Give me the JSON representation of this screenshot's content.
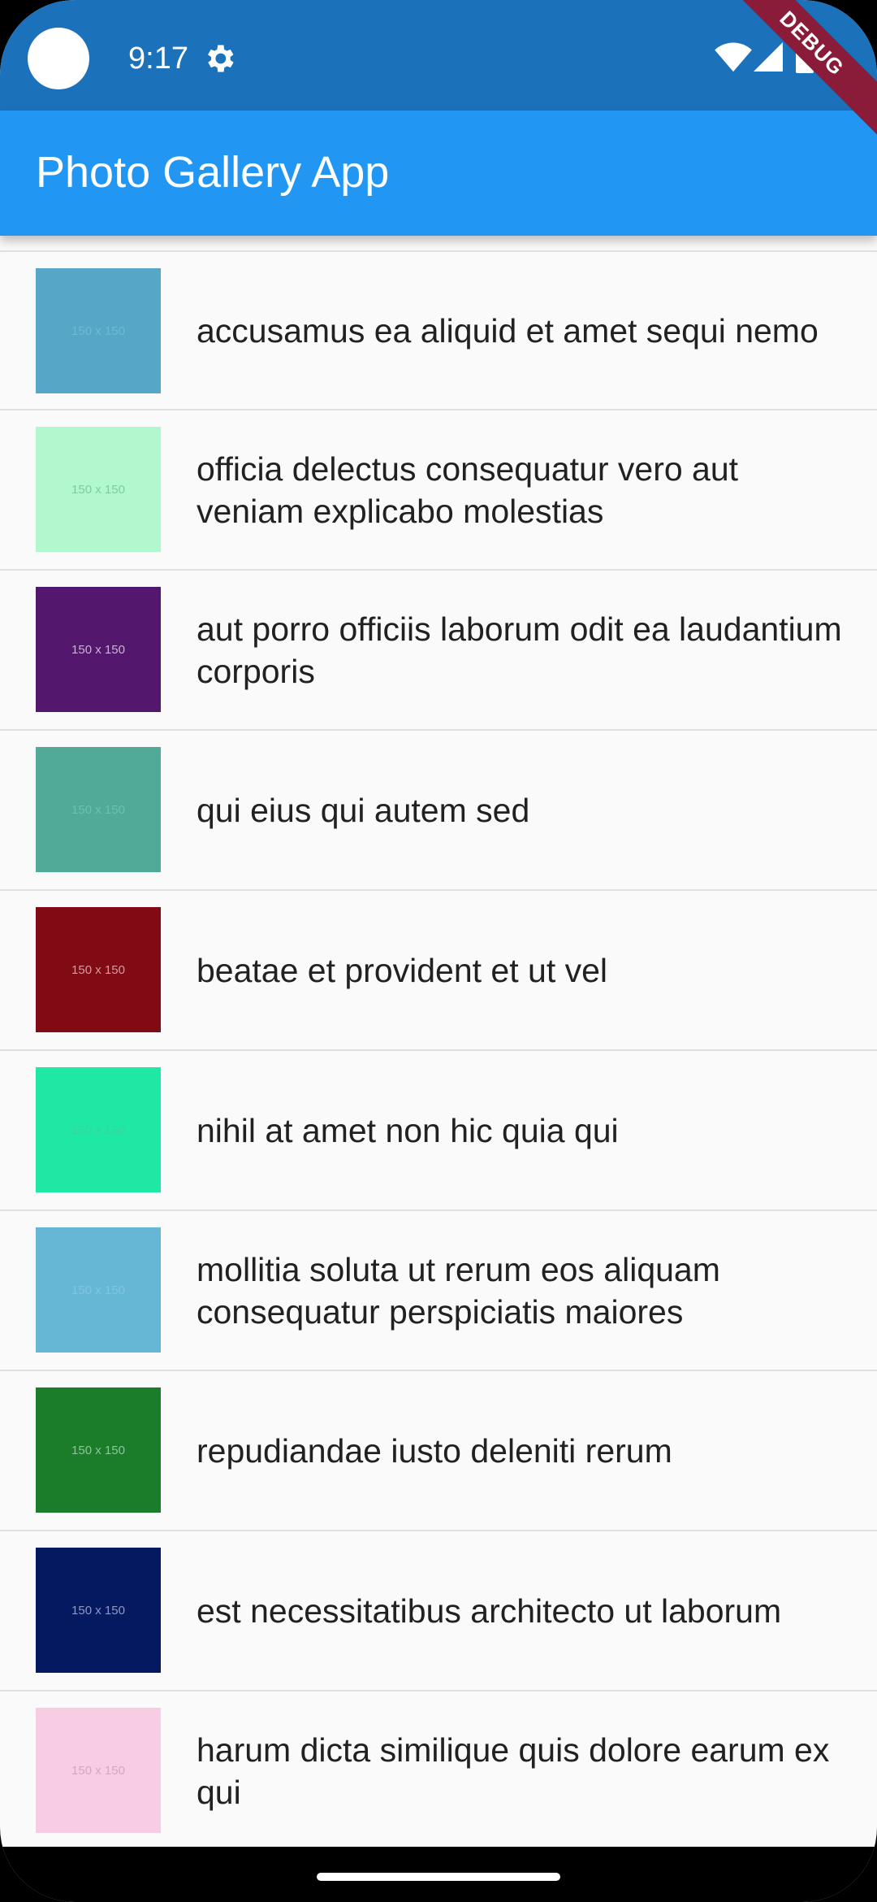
{
  "status_bar": {
    "time": "9:17",
    "icons": [
      "camera-dot",
      "settings-icon",
      "wifi-icon",
      "signal-icon",
      "battery-icon"
    ],
    "color": "#1c72ba"
  },
  "debug_banner": "DEBUG",
  "app_bar": {
    "title": "Photo Gallery App",
    "color": "#2196f3"
  },
  "photos": [
    {
      "title": "accusamus ea aliquid et amet sequi nemo",
      "thumb_label": "150 x 150",
      "color": "#56a6c8",
      "label_color": "#6fb8d6"
    },
    {
      "title": "officia delectus consequatur vero aut veniam explicabo molestias",
      "thumb_label": "150 x 150",
      "color": "#b1f8cf",
      "label_color": "#7fcca3"
    },
    {
      "title": "aut porro officiis laborum odit ea laudantium corporis",
      "thumb_label": "150 x 150",
      "color": "#54176e",
      "label_color": "#c9b2d6"
    },
    {
      "title": "qui eius qui autem sed",
      "thumb_label": "150 x 150",
      "color": "#51aa97",
      "label_color": "#6fbfae"
    },
    {
      "title": "beatae et provident et ut vel",
      "thumb_label": "150 x 150",
      "color": "#810b14",
      "label_color": "#d79aa0"
    },
    {
      "title": "nihil at amet non hic quia qui",
      "thumb_label": "150 x 150",
      "color": "#1ee8a4",
      "label_color": "#3bd4a0"
    },
    {
      "title": "mollitia soluta ut rerum eos aliquam consequatur perspiciatis maiores",
      "thumb_label": "150 x 150",
      "color": "#66b7d5",
      "label_color": "#7fc6e0"
    },
    {
      "title": "repudiandae iusto deleniti rerum",
      "thumb_label": "150 x 150",
      "color": "#1b7c2a",
      "label_color": "#8fc49a"
    },
    {
      "title": "est necessitatibus architecto ut laborum",
      "thumb_label": "150 x 150",
      "color": "#051960",
      "label_color": "#8e9ac2"
    },
    {
      "title": "harum dicta similique quis dolore earum ex qui",
      "thumb_label": "150 x 150",
      "color": "#f8cde3",
      "label_color": "#d5a7bf"
    }
  ]
}
